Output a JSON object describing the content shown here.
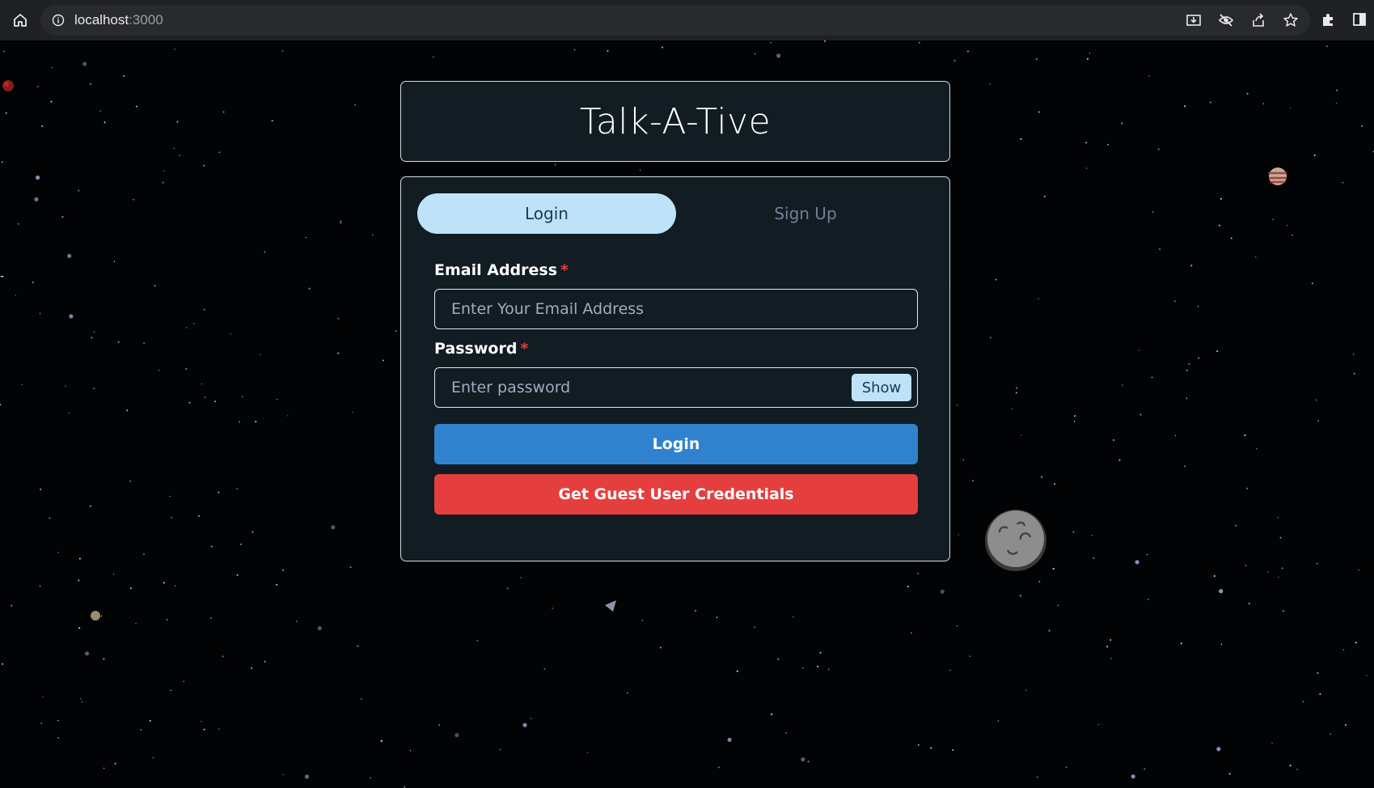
{
  "browser": {
    "url_host": "localhost",
    "url_port": ":3000"
  },
  "app": {
    "title": "Talk-A-Tive"
  },
  "tabs": [
    {
      "label": "Login",
      "active": true
    },
    {
      "label": "Sign Up",
      "active": false
    }
  ],
  "form": {
    "email_label": "Email Address",
    "email_placeholder": "Enter Your Email Address",
    "email_value": "",
    "password_label": "Password",
    "password_placeholder": "Enter password",
    "password_value": "",
    "required_mark": "*",
    "show_label": "Show",
    "login_label": "Login",
    "guest_label": "Get Guest User Credentials"
  },
  "colors": {
    "card_bg": "#111c23",
    "tab_active_bg": "#bee3f8",
    "primary": "#3182ce",
    "danger": "#e53e3e"
  },
  "icons": {
    "home": "home-icon",
    "info": "info-icon",
    "install": "install-icon",
    "tracking": "eye-off-icon",
    "share": "share-icon",
    "bookmark": "star-icon",
    "extensions": "puzzle-icon",
    "side_panel": "side-panel-icon"
  }
}
